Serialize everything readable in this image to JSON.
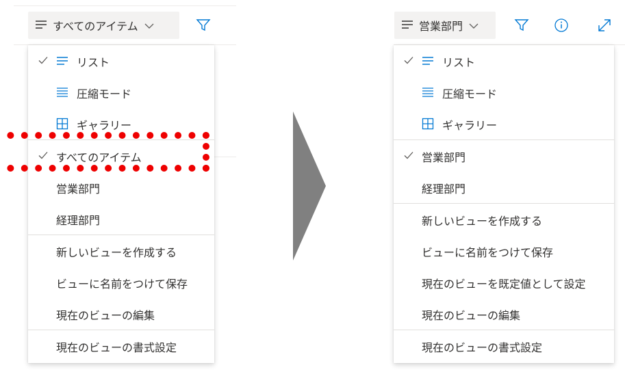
{
  "left": {
    "view_button_label": "すべてのアイテム",
    "menu": {
      "layouts": [
        {
          "label": "リスト",
          "checked": true,
          "icon": "list-icon"
        },
        {
          "label": "圧縮モード",
          "checked": false,
          "icon": "compact-icon"
        },
        {
          "label": "ギャラリー",
          "checked": false,
          "icon": "gallery-icon"
        }
      ],
      "views": [
        {
          "label": "すべてのアイテム",
          "checked": true
        },
        {
          "label": "営業部門",
          "checked": false
        },
        {
          "label": "経理部門",
          "checked": false
        }
      ],
      "actions": [
        {
          "label": "新しいビューを作成する"
        },
        {
          "label": "ビューに名前をつけて保存"
        },
        {
          "label": "現在のビューの編集"
        }
      ],
      "format": {
        "label": "現在のビューの書式設定"
      }
    }
  },
  "right": {
    "view_button_label": "営業部門",
    "menu": {
      "layouts": [
        {
          "label": "リスト",
          "checked": true,
          "icon": "list-icon"
        },
        {
          "label": "圧縮モード",
          "checked": false,
          "icon": "compact-icon"
        },
        {
          "label": "ギャラリー",
          "checked": false,
          "icon": "gallery-icon"
        }
      ],
      "views": [
        {
          "label": "営業部門",
          "checked": true
        },
        {
          "label": "経理部門",
          "checked": false
        }
      ],
      "actions": [
        {
          "label": "新しいビューを作成する"
        },
        {
          "label": "ビューに名前をつけて保存"
        },
        {
          "label": "現在のビューを既定値として設定"
        },
        {
          "label": "現在のビューの編集"
        }
      ],
      "format": {
        "label": "現在のビューの書式設定"
      }
    }
  },
  "colors": {
    "accent": "#0078d4",
    "text": "#323130",
    "highlight_border": "#ee0000",
    "arrow": "#808080"
  }
}
